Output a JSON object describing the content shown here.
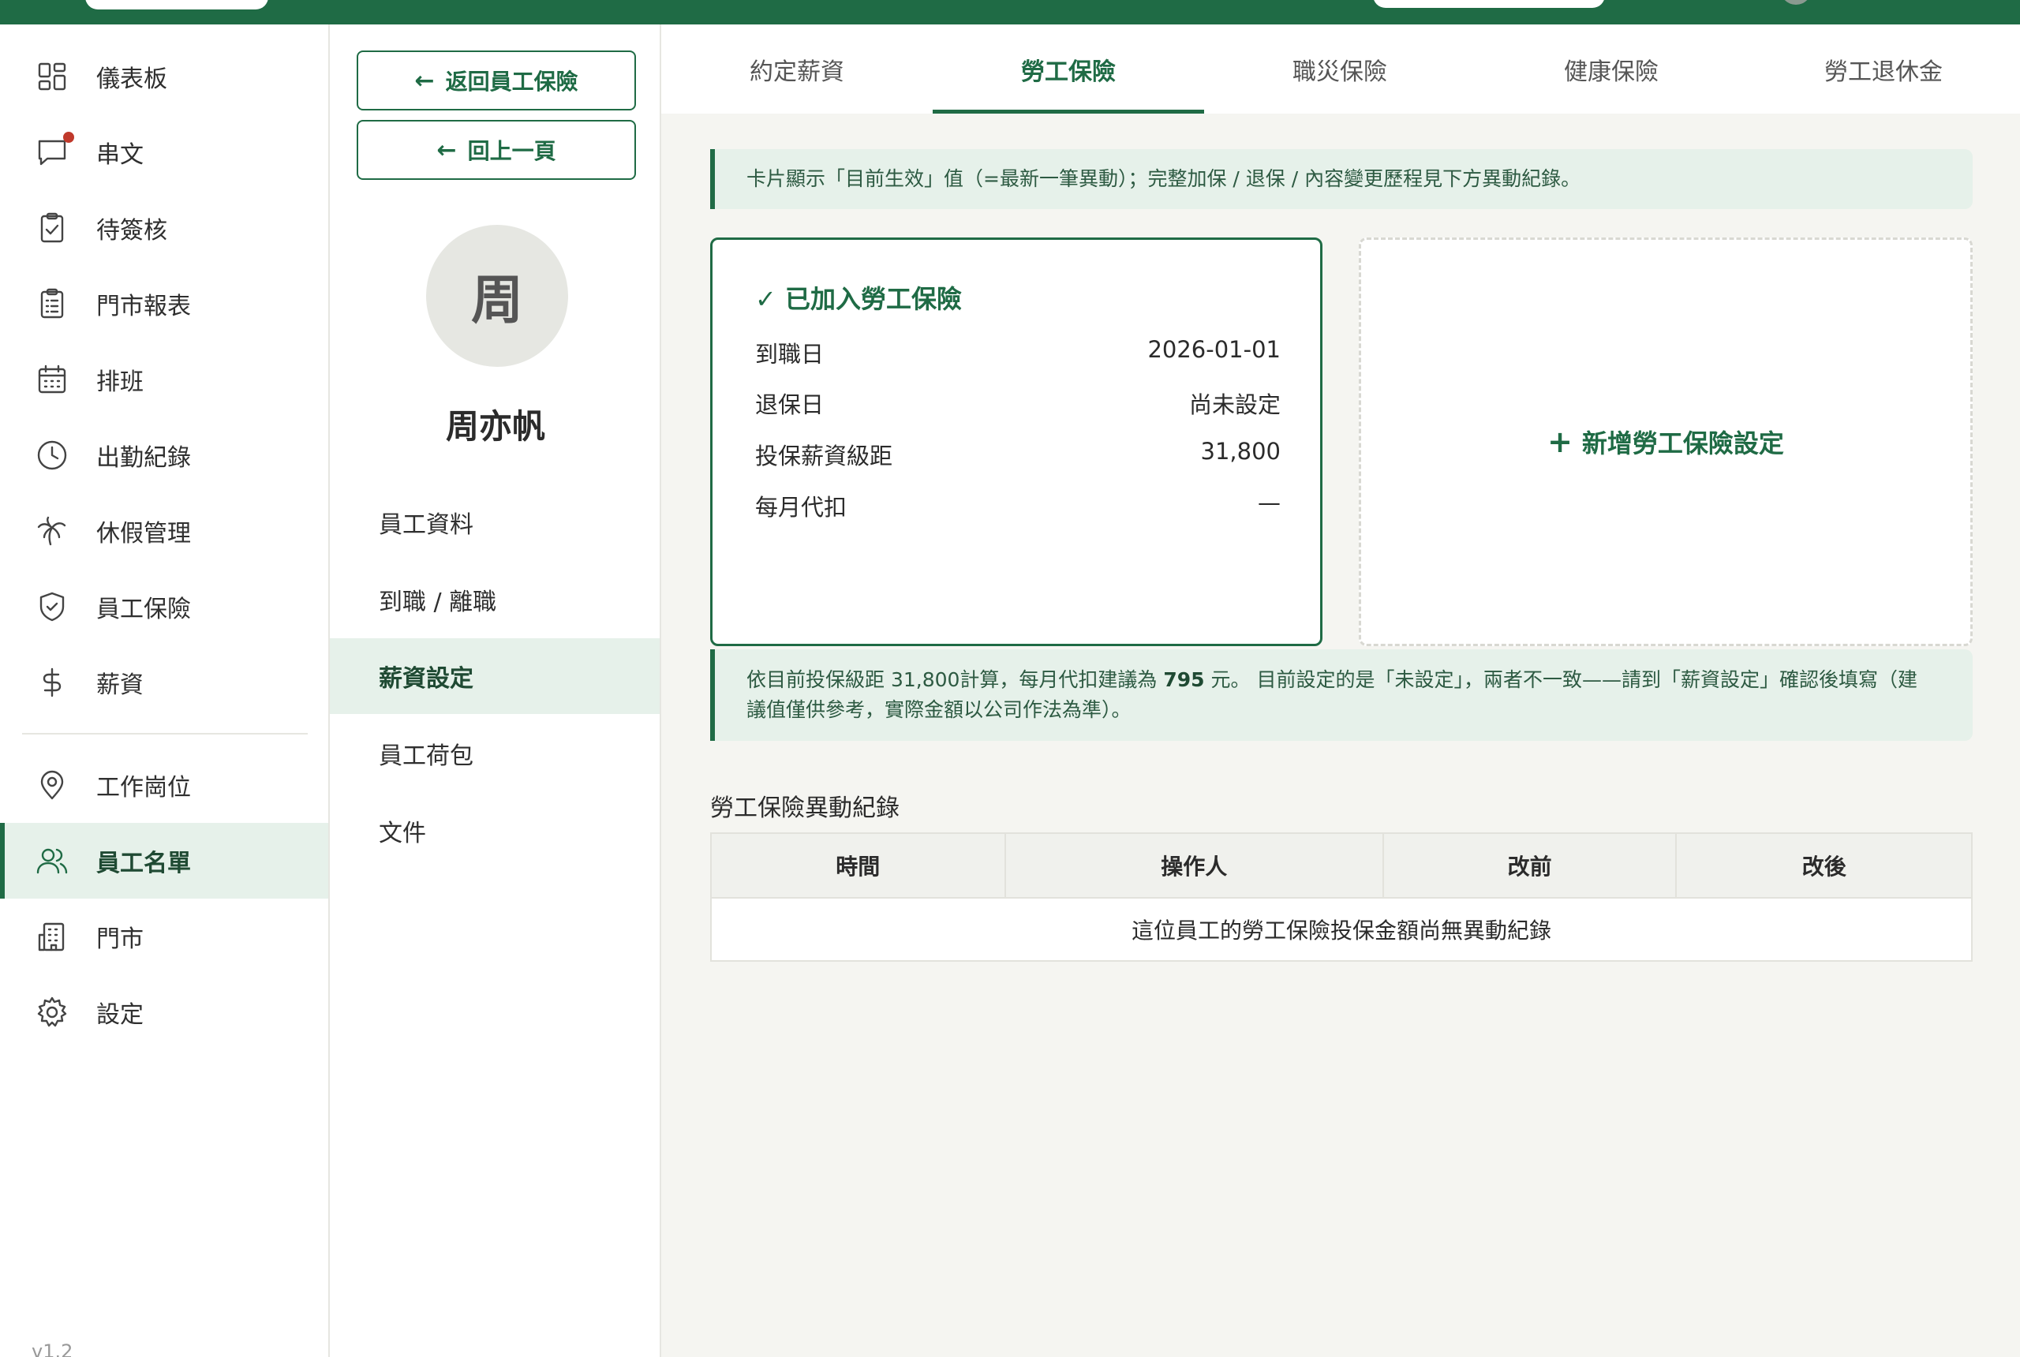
{
  "sidebar": {
    "items": [
      {
        "label": "儀表板",
        "icon": "dashboard-icon"
      },
      {
        "label": "串文",
        "icon": "chat-icon"
      },
      {
        "label": "待簽核",
        "icon": "clipboard-check-icon"
      },
      {
        "label": "門市報表",
        "icon": "clipboard-list-icon"
      },
      {
        "label": "排班",
        "icon": "calendar-icon"
      },
      {
        "label": "出勤紀錄",
        "icon": "clock-icon"
      },
      {
        "label": "休假管理",
        "icon": "palm-tree-icon"
      },
      {
        "label": "員工保險",
        "icon": "shield-icon"
      },
      {
        "label": "薪資",
        "icon": "dollar-icon"
      },
      {
        "label": "工作崗位",
        "icon": "map-pin-icon"
      },
      {
        "label": "員工名單",
        "icon": "users-icon"
      },
      {
        "label": "門市",
        "icon": "building-icon"
      },
      {
        "label": "設定",
        "icon": "gear-icon"
      }
    ],
    "version": "v1.2"
  },
  "subcol": {
    "back_insurance": "返回員工保險",
    "back_prev": "回上一頁",
    "avatar_initial": "周",
    "employee_name": "周亦帆",
    "items": [
      "員工資料",
      "到職 / 離職",
      "薪資設定",
      "員工荷包",
      "文件"
    ]
  },
  "tabs": [
    "約定薪資",
    "勞工保險",
    "職災保險",
    "健康保險",
    "勞工退休金"
  ],
  "notice_top": "卡片顯示「目前生效」值（=最新一筆異動）；完整加保 / 退保 / 內容變更歷程見下方異動紀錄。",
  "status_card": {
    "title": "已加入勞工保險",
    "rows": [
      {
        "key": "到職日",
        "value": "2026-01-01"
      },
      {
        "key": "退保日",
        "value": "尚未設定"
      },
      {
        "key": "投保薪資級距",
        "value": "31,800"
      },
      {
        "key": "每月代扣",
        "value": "—"
      }
    ]
  },
  "add_card": {
    "label": "新增勞工保險設定"
  },
  "notice_bottom": {
    "pre": "依目前投保級距 31,800計算，每月代扣建議為 ",
    "amount": "795",
    "line1_post": " 元。 目前設定的是「未設定」，兩者不一致——請到「薪資設定」確認後填寫（建",
    "line2": "議值僅供參考，實際金額以公司作法為準）。"
  },
  "history": {
    "title": "勞工保險異動紀錄",
    "columns": [
      "時間",
      "操作人",
      "改前",
      "改後"
    ],
    "empty": "這位員工的勞工保險投保金額尚無異動紀錄"
  }
}
